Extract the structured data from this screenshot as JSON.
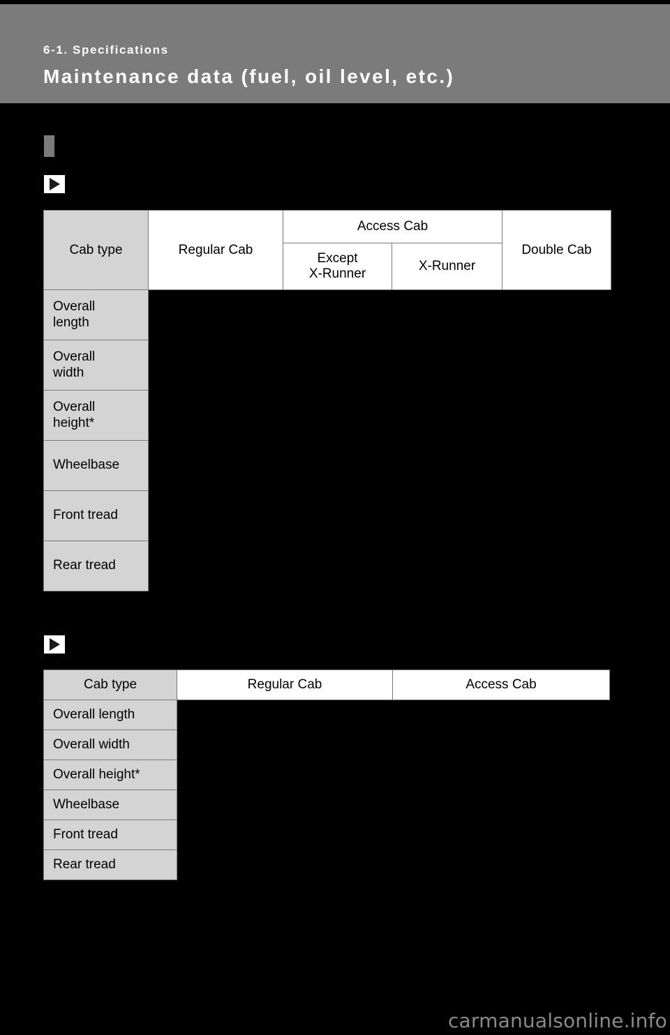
{
  "header": {
    "breadcrumb": "6-1. Specifications",
    "title": "Maintenance data (fuel, oil level, etc.)",
    "band_color": "#7b7b7b",
    "text_color": "#ffffff"
  },
  "markers": {
    "section_block_color": "#7b7b7b",
    "arrow_icon_name": "play-triangle-icon"
  },
  "tables": [
    {
      "id": "dimensions-in",
      "header": {
        "row_label": "Cab type",
        "columns": [
          {
            "label": "Regular Cab",
            "sub": []
          },
          {
            "label": "Access Cab",
            "sub": [
              "Except\nX-Runner",
              "X-Runner"
            ]
          },
          {
            "label": "Double Cab",
            "sub": []
          }
        ],
        "sub_except": "Except",
        "sub_except_line2": "X-Runner",
        "sub_xrunner": "X-Runner"
      },
      "rows": [
        {
          "label_line1": "Overall",
          "label_line2": "length",
          "values": [
            "",
            "",
            "",
            ""
          ]
        },
        {
          "label_line1": "Overall",
          "label_line2": "width",
          "values": [
            "",
            "",
            "",
            ""
          ]
        },
        {
          "label_line1": "Overall",
          "label_line2": "height*",
          "values": [
            "",
            "",
            "",
            ""
          ]
        },
        {
          "label_line1": "Wheelbase",
          "label_line2": "",
          "values": [
            "",
            "",
            "",
            ""
          ]
        },
        {
          "label_line1": "Front tread",
          "label_line2": "",
          "values": [
            "",
            "",
            "",
            ""
          ]
        },
        {
          "label_line1": "Rear tread",
          "label_line2": "",
          "values": [
            "",
            "",
            "",
            ""
          ]
        }
      ]
    },
    {
      "id": "dimensions-mm",
      "header": {
        "row_label": "Cab type",
        "columns": [
          {
            "label": "Regular Cab"
          },
          {
            "label": "Access Cab"
          }
        ]
      },
      "rows": [
        {
          "label": "Overall length",
          "values": [
            "",
            ""
          ]
        },
        {
          "label": "Overall width",
          "values": [
            "",
            ""
          ]
        },
        {
          "label": "Overall height*",
          "values": [
            "",
            ""
          ]
        },
        {
          "label": "Wheelbase",
          "values": [
            "",
            ""
          ]
        },
        {
          "label": "Front tread",
          "values": [
            "",
            ""
          ]
        },
        {
          "label": "Rear tread",
          "values": [
            "",
            ""
          ]
        }
      ]
    }
  ],
  "watermark": {
    "text": "carmanualsonline.info",
    "color": "#8a8a8a"
  }
}
